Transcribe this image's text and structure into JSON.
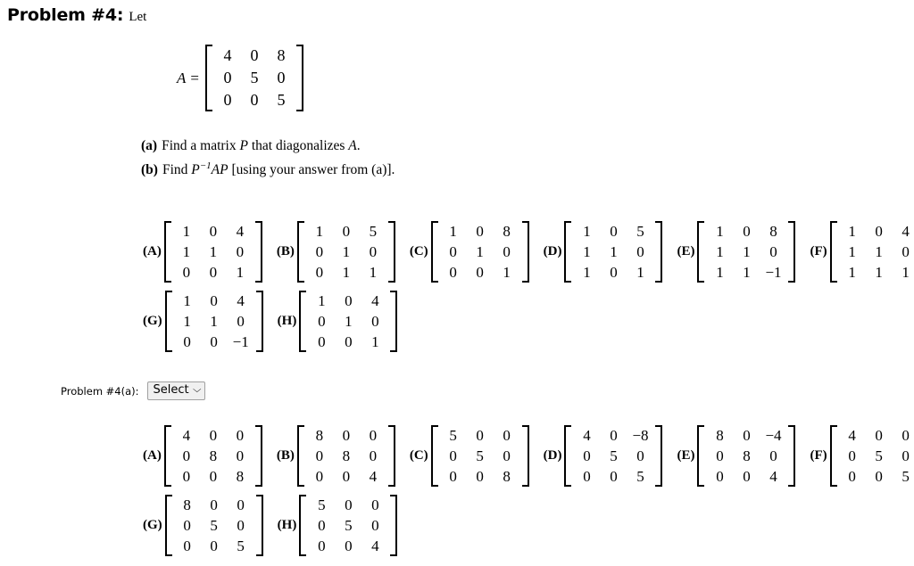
{
  "header": {
    "problem_label": "Problem #4:",
    "lead_text": "Let"
  },
  "equation": {
    "lhs": "A",
    "equals": "=",
    "matrix": [
      [
        "4",
        "0",
        "8"
      ],
      [
        "0",
        "5",
        "0"
      ],
      [
        "0",
        "0",
        "5"
      ]
    ]
  },
  "parts": [
    {
      "tag": "(a)",
      "text_1": "Find a matrix ",
      "var_1": "P",
      "text_2": " that diagonalizes ",
      "var_2": "A",
      "text_3": "."
    },
    {
      "tag": "(b)",
      "text_1": "Find ",
      "var_1": "P",
      "sup": "−1",
      "var_2": "AP",
      "text_2": " [using your answer from (a)]."
    }
  ],
  "answer_options_a": {
    "row1": [
      {
        "tag": "(A)",
        "matrix": [
          [
            "1",
            "0",
            "4"
          ],
          [
            "1",
            "1",
            "0"
          ],
          [
            "0",
            "0",
            "1"
          ]
        ]
      },
      {
        "tag": "(B)",
        "matrix": [
          [
            "1",
            "0",
            "5"
          ],
          [
            "0",
            "1",
            "0"
          ],
          [
            "0",
            "1",
            "1"
          ]
        ]
      },
      {
        "tag": "(C)",
        "matrix": [
          [
            "1",
            "0",
            "8"
          ],
          [
            "0",
            "1",
            "0"
          ],
          [
            "0",
            "0",
            "1"
          ]
        ]
      },
      {
        "tag": "(D)",
        "matrix": [
          [
            "1",
            "0",
            "5"
          ],
          [
            "1",
            "1",
            "0"
          ],
          [
            "1",
            "0",
            "1"
          ]
        ]
      },
      {
        "tag": "(E)",
        "matrix": [
          [
            "1",
            "0",
            "8"
          ],
          [
            "1",
            "1",
            "0"
          ],
          [
            "1",
            "1",
            "−1"
          ]
        ]
      },
      {
        "tag": "(F)",
        "matrix": [
          [
            "1",
            "0",
            "4"
          ],
          [
            "1",
            "1",
            "0"
          ],
          [
            "1",
            "1",
            "1"
          ]
        ]
      }
    ],
    "row2": [
      {
        "tag": "(G)",
        "matrix": [
          [
            "1",
            "0",
            "4"
          ],
          [
            "1",
            "1",
            "0"
          ],
          [
            "0",
            "0",
            "−1"
          ]
        ]
      },
      {
        "tag": "(H)",
        "matrix": [
          [
            "1",
            "0",
            "4"
          ],
          [
            "0",
            "1",
            "0"
          ],
          [
            "0",
            "0",
            "1"
          ]
        ]
      }
    ]
  },
  "select_control": {
    "label": "Problem #4(a):",
    "value": "Select",
    "chevron": "⌵"
  },
  "answer_options_b": {
    "row1": [
      {
        "tag": "(A)",
        "matrix": [
          [
            "4",
            "0",
            "0"
          ],
          [
            "0",
            "8",
            "0"
          ],
          [
            "0",
            "0",
            "8"
          ]
        ]
      },
      {
        "tag": "(B)",
        "matrix": [
          [
            "8",
            "0",
            "0"
          ],
          [
            "0",
            "8",
            "0"
          ],
          [
            "0",
            "0",
            "4"
          ]
        ]
      },
      {
        "tag": "(C)",
        "matrix": [
          [
            "5",
            "0",
            "0"
          ],
          [
            "0",
            "5",
            "0"
          ],
          [
            "0",
            "0",
            "8"
          ]
        ]
      },
      {
        "tag": "(D)",
        "matrix": [
          [
            "4",
            "0",
            "−8"
          ],
          [
            "0",
            "5",
            "0"
          ],
          [
            "0",
            "0",
            "5"
          ]
        ]
      },
      {
        "tag": "(E)",
        "matrix": [
          [
            "8",
            "0",
            "−4"
          ],
          [
            "0",
            "8",
            "0"
          ],
          [
            "0",
            "0",
            "4"
          ]
        ]
      },
      {
        "tag": "(F)",
        "matrix": [
          [
            "4",
            "0",
            "0"
          ],
          [
            "0",
            "5",
            "0"
          ],
          [
            "0",
            "0",
            "5"
          ]
        ]
      }
    ],
    "row2": [
      {
        "tag": "(G)",
        "matrix": [
          [
            "8",
            "0",
            "0"
          ],
          [
            "0",
            "5",
            "0"
          ],
          [
            "0",
            "0",
            "5"
          ]
        ]
      },
      {
        "tag": "(H)",
        "matrix": [
          [
            "5",
            "0",
            "0"
          ],
          [
            "0",
            "5",
            "0"
          ],
          [
            "0",
            "0",
            "4"
          ]
        ]
      }
    ]
  }
}
